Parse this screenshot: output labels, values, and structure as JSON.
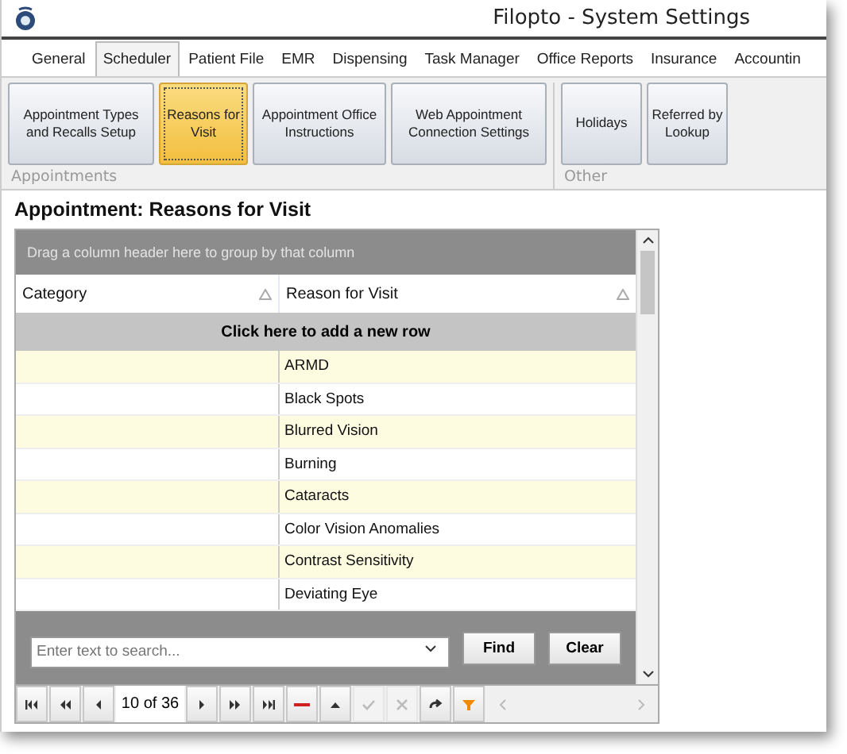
{
  "window": {
    "title": "Filopto - System Settings"
  },
  "tabs": [
    {
      "label": "General",
      "selected": false
    },
    {
      "label": "Scheduler",
      "selected": true
    },
    {
      "label": "Patient File",
      "selected": false
    },
    {
      "label": "EMR",
      "selected": false
    },
    {
      "label": "Dispensing",
      "selected": false
    },
    {
      "label": "Task Manager",
      "selected": false
    },
    {
      "label": "Office Reports",
      "selected": false
    },
    {
      "label": "Insurance",
      "selected": false
    },
    {
      "label": "Accountin",
      "selected": false
    }
  ],
  "ribbon_groups": [
    {
      "label": "Appointments",
      "buttons": [
        {
          "label": "Appointment Types and Recalls Setup",
          "selected": false
        },
        {
          "label": "Reasons for Visit",
          "selected": true
        },
        {
          "label": "Appointment Office Instructions",
          "selected": false
        },
        {
          "label": "Web Appointment Connection Settings",
          "selected": false
        }
      ]
    },
    {
      "label": "Other",
      "buttons": [
        {
          "label": "Holidays",
          "selected": false
        },
        {
          "label": "Referred by Lookup",
          "selected": false
        }
      ]
    }
  ],
  "heading": "Appointment: Reasons for Visit",
  "grid": {
    "group_hint": "Drag a column header here to group by that column",
    "columns": [
      "Category",
      "Reason for Visit"
    ],
    "add_row": "Click here to add a new row",
    "rows": [
      {
        "category": "",
        "reason": "ARMD"
      },
      {
        "category": "",
        "reason": "Black Spots"
      },
      {
        "category": "",
        "reason": "Blurred Vision"
      },
      {
        "category": "",
        "reason": "Burning"
      },
      {
        "category": "",
        "reason": "Cataracts"
      },
      {
        "category": "",
        "reason": "Color Vision Anomalies"
      },
      {
        "category": "",
        "reason": "Contrast Sensitivity"
      },
      {
        "category": "",
        "reason": "Deviating Eye"
      }
    ]
  },
  "search": {
    "placeholder": "Enter text to search...",
    "buttons": [
      "Find",
      "Clear"
    ]
  },
  "pager": {
    "counter": "10 of 36",
    "buttons": [
      {
        "kind": "first"
      },
      {
        "kind": "prevpage"
      },
      {
        "kind": "prev"
      },
      {
        "kind": "counter"
      },
      {
        "kind": "next"
      },
      {
        "kind": "nextpage"
      },
      {
        "kind": "last"
      },
      {
        "kind": "delete"
      },
      {
        "kind": "up"
      },
      {
        "kind": "accept",
        "disabled": true
      },
      {
        "kind": "cancel",
        "disabled": true
      },
      {
        "kind": "redo"
      },
      {
        "kind": "filter"
      }
    ]
  }
}
